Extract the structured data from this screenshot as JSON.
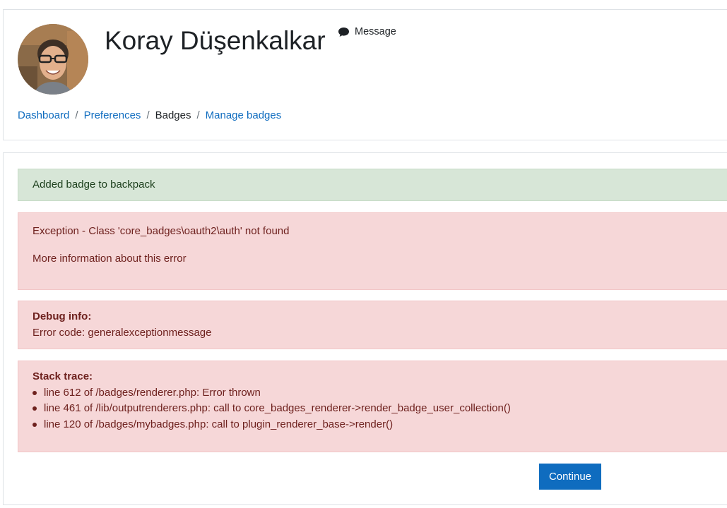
{
  "header": {
    "user_name": "Koray Düşenkalkar",
    "message_label": "Message",
    "breadcrumb": [
      {
        "label": "Dashboard",
        "link": true
      },
      {
        "label": "Preferences",
        "link": true
      },
      {
        "label": "Badges",
        "link": false
      },
      {
        "label": "Manage badges",
        "link": true
      }
    ]
  },
  "notifications": {
    "success": "Added badge to backpack",
    "exception": "Exception - Class 'core_badges\\oauth2\\auth' not found",
    "more_info": "More information about this error"
  },
  "debug": {
    "title": "Debug info:",
    "error_code": "Error code: generalexceptionmessage"
  },
  "stack": {
    "title": "Stack trace:",
    "lines": [
      "line 612 of /badges/renderer.php: Error thrown",
      "line 461 of /lib/outputrenderers.php: call to core_badges_renderer->render_badge_user_collection()",
      "line 120 of /badges/mybadges.php: call to plugin_renderer_base->render()"
    ]
  },
  "actions": {
    "continue_label": "Continue"
  },
  "colors": {
    "link": "#0f6cbf",
    "success_bg": "#d7e6d7",
    "error_bg": "#f6d7d8",
    "primary_button": "#0f6cbf"
  }
}
